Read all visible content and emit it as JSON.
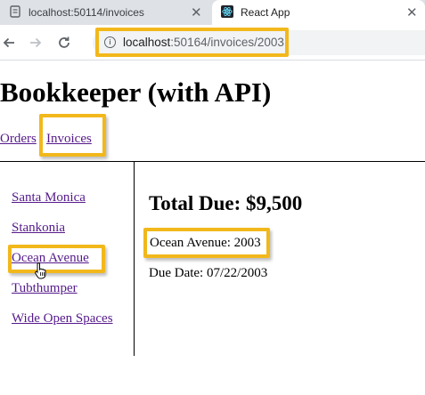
{
  "browser": {
    "tabs": [
      {
        "title": "localhost:50114/invoices",
        "icon": "page-icon",
        "active": false
      },
      {
        "title": "React App",
        "icon": "react-logo-icon",
        "active": true
      }
    ],
    "url_host": "localhost",
    "url_path": ":50164/invoices/2003",
    "highlight_color": "#f2b81b"
  },
  "app": {
    "title": "Bookkeeper (with API)",
    "nav": {
      "orders": "Orders",
      "invoices": "Invoices"
    }
  },
  "sidebar": {
    "items": [
      {
        "label": "Santa Monica"
      },
      {
        "label": "Stankonia"
      },
      {
        "label": "Ocean Avenue"
      },
      {
        "label": "Tubthumper"
      },
      {
        "label": "Wide Open Spaces"
      }
    ]
  },
  "invoice": {
    "total_due": "Total Due: $9,500",
    "name_number": "Ocean Avenue: 2003",
    "due_date": "Due Date: 07/22/2003"
  }
}
